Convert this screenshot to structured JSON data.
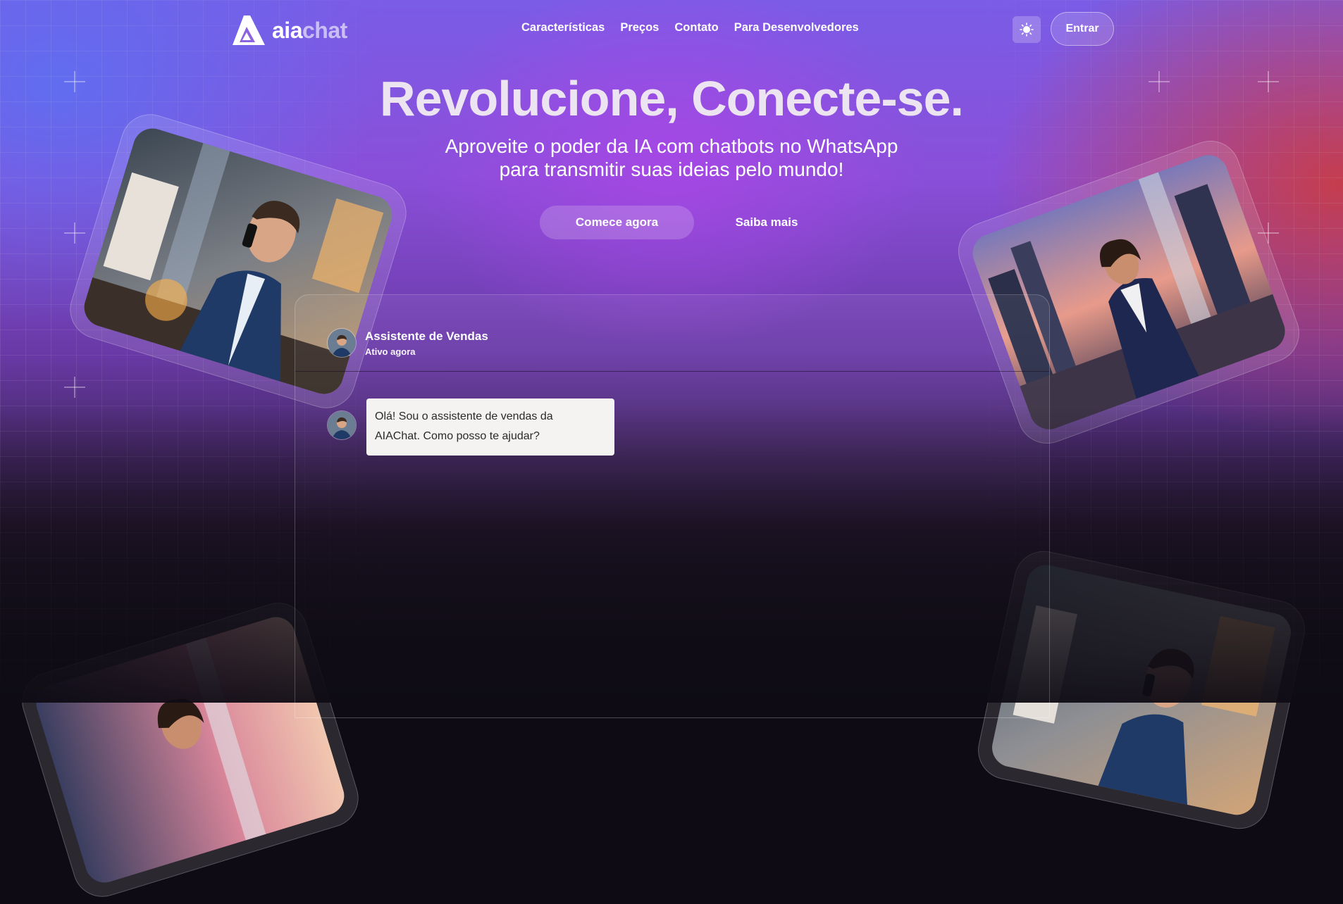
{
  "brand": {
    "name_part1": "aia",
    "name_part2": "chat"
  },
  "nav": {
    "items": [
      {
        "label": "Características"
      },
      {
        "label": "Preços"
      },
      {
        "label": "Contato"
      },
      {
        "label": "Para Desenvolvedores"
      }
    ]
  },
  "header": {
    "theme_toggle_icon": "sun-icon",
    "login_label": "Entrar"
  },
  "hero": {
    "title": "Revolucione, Conecte-se.",
    "subtitle_line1": "Aproveite o poder da IA com chatbots no WhatsApp",
    "subtitle_line2": "para transmitir suas ideias pelo mundo!",
    "primary_cta": "Comece agora",
    "secondary_cta": "Saiba mais"
  },
  "chat": {
    "agent_name": "Assistente de Vendas",
    "agent_status": "Ativo agora",
    "messages": [
      {
        "sender": "agent",
        "text_line1": "Olá! Sou o assistente de vendas da",
        "text_line2": "AIAChat. Como posso te ajudar?"
      }
    ]
  },
  "colors": {
    "accent_purple": "#8a4fd9",
    "accent_red": "#c83c46",
    "accent_blue": "#5f6ef0",
    "bubble_bg": "#f4f3f1"
  },
  "images": [
    {
      "name": "businessman-phone-photo"
    },
    {
      "name": "businesswoman-city-photo"
    },
    {
      "name": "businesswoman-photo-bottom-left"
    },
    {
      "name": "businessman-phone-photo-bottom-right"
    }
  ]
}
